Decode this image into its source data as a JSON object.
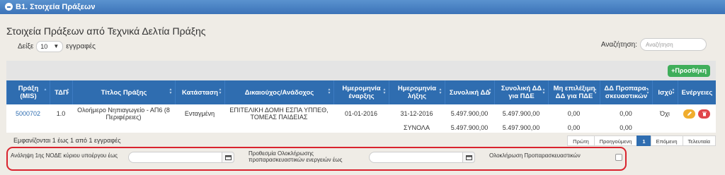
{
  "section": {
    "title": "Β1. Στοιχεία Πράξεων"
  },
  "panel": {
    "title": "Στοιχεία Πράξεων από Τεχνικά Δελτία Πράξης"
  },
  "length": {
    "prefix": "Δείξε",
    "value": "10",
    "suffix": "εγγραφές"
  },
  "search": {
    "label": "Αναζήτηση:",
    "placeholder": "Αναζήτηση",
    "value": ""
  },
  "toolbar": {
    "add_label": "+Προσθήκη"
  },
  "columns": [
    {
      "label": "Πράξη\n(MIS)",
      "sortable": true,
      "sort": "asc"
    },
    {
      "label": "ΤΔΠ",
      "sortable": true,
      "sort": "none"
    },
    {
      "label": "Τίτλος Πράξης",
      "sortable": true,
      "sort": "none"
    },
    {
      "label": "Κατάσταση",
      "sortable": true,
      "sort": "none"
    },
    {
      "label": "Δικαιούχος/Ανάδοχος",
      "sortable": true,
      "sort": "none"
    },
    {
      "label": "Ημερομηνία\nέναρξης",
      "sortable": true,
      "sort": "none"
    },
    {
      "label": "Ημερομηνία\nλήξης",
      "sortable": true,
      "sort": "none"
    },
    {
      "label": "Συνολική ΔΔ",
      "sortable": true,
      "sort": "none"
    },
    {
      "label": "Συνολική ΔΔ\nγια ΠΔΕ",
      "sortable": true,
      "sort": "none"
    },
    {
      "label": "Μη επιλέξιμη\nΔΔ για ΠΔΕ",
      "sortable": true,
      "sort": "none"
    },
    {
      "label": "ΔΔ Προπαρα-\nσκευαστικών",
      "sortable": true,
      "sort": "none"
    },
    {
      "label": "Ισχύ",
      "sortable": true,
      "sort": "none"
    },
    {
      "label": "Ενέργειες",
      "sortable": false,
      "sort": "none"
    }
  ],
  "rows": [
    {
      "cells": [
        "5000702",
        "1.0",
        "Ολοήμερο Νηπιαγωγείο - ΑΠ6 (8\nΠεριφέρειες)",
        "Ενταγμένη",
        "ΕΠΙΤΕΛΙΚΗ ΔΟΜΗ ΕΣΠΑ ΥΠΠΕΘ,\nΤΟΜΕΑΣ ΠΑΙΔΕΙΑΣ",
        "01-01-2016",
        "31-12-2016",
        "5.497.900,00",
        "5.497.900,00",
        "0,00",
        "0,00",
        "Όχι"
      ],
      "actions": [
        {
          "name": "edit-button",
          "icon": "pencil-icon"
        },
        {
          "name": "delete-button",
          "icon": "trash-icon"
        }
      ]
    }
  ],
  "totals": {
    "label": "ΣΥΝΟΛΑ",
    "values": [
      "5.497.900,00",
      "5.497.900,00",
      "0,00",
      "0,00"
    ]
  },
  "info": "Εμφανίζονται 1 έως 1 από 1 εγγραφές",
  "pagination": [
    {
      "label": "Πρώτη",
      "active": false
    },
    {
      "label": "Προηγούμενη",
      "active": false
    },
    {
      "label": "1",
      "active": true
    },
    {
      "label": "Επόμενη",
      "active": false
    },
    {
      "label": "Τελευταία",
      "active": false
    }
  ],
  "form": {
    "field1": {
      "label": "Ανάληψη 1ης ΝΟΔΕ κύριου υποέργου έως",
      "value": ""
    },
    "field2": {
      "label": "Προθεσμία Ολοκλήρωσης\nπροπαρασκευαστικών ενεργειών έως",
      "value": ""
    },
    "field3": {
      "label": "Ολοκλήρωση Προπαρασκευαστικών",
      "checked": false
    }
  },
  "colors": {
    "page_bg": "#efece6",
    "header_blue": "#2f6db0",
    "accent_blue": "#2f6db0",
    "add_green": "#3fae5b",
    "edit_orange": "#f0ad2e",
    "delete_red": "#e0454a",
    "highlight_red": "#d9232e"
  }
}
